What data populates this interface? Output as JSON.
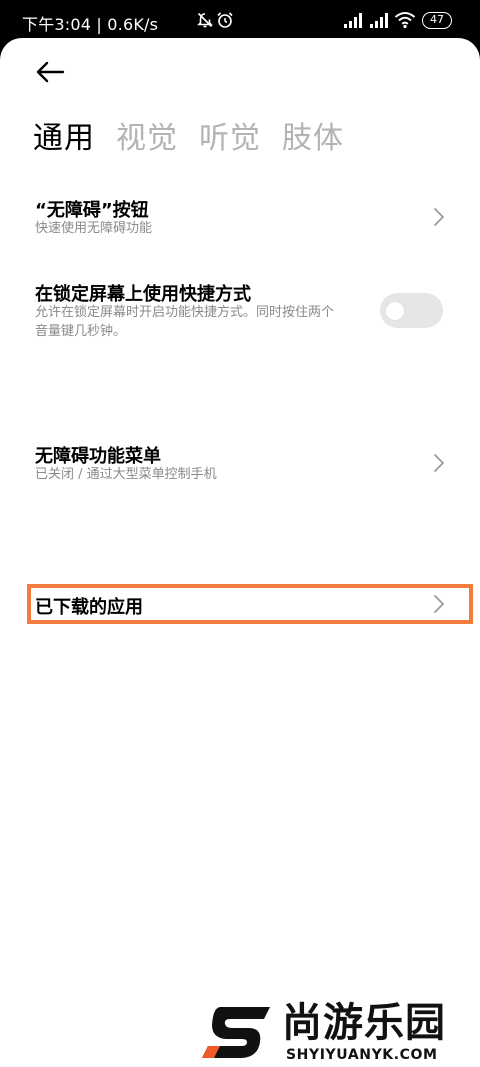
{
  "status_bar": {
    "time_speed": "下午3:04 | 0.6K/s",
    "battery": "47",
    "icons": [
      "alarm-off-icon",
      "alarm-icon",
      "signal-icon",
      "signal-icon",
      "wifi-icon",
      "battery-icon"
    ]
  },
  "header": {
    "back_icon": "back-arrow-icon"
  },
  "tabs": [
    {
      "label": "通用",
      "active": true
    },
    {
      "label": "视觉",
      "active": false
    },
    {
      "label": "听觉",
      "active": false
    },
    {
      "label": "肢体",
      "active": false
    }
  ],
  "settings": {
    "accessibility_button": {
      "title": "“无障碍”按钮",
      "subtitle": "快速使用无障碍功能"
    },
    "lock_screen_shortcut": {
      "title": "在锁定屏幕上使用快捷方式",
      "subtitle_line1": "允许在锁定屏幕时开启功能快捷方式。同时按住两个",
      "subtitle_line2": "音量键几秒钟。",
      "toggle_on": false
    },
    "accessibility_menu": {
      "title": "无障碍功能菜单",
      "subtitle": "已关闭 / 通过大型菜单控制手机"
    },
    "downloaded_apps": {
      "title": "已下载的应用"
    }
  },
  "highlight_color": "#f47b3e",
  "watermark": {
    "name": "尚游乐园",
    "url": "SHYIYUANYK.COM"
  }
}
